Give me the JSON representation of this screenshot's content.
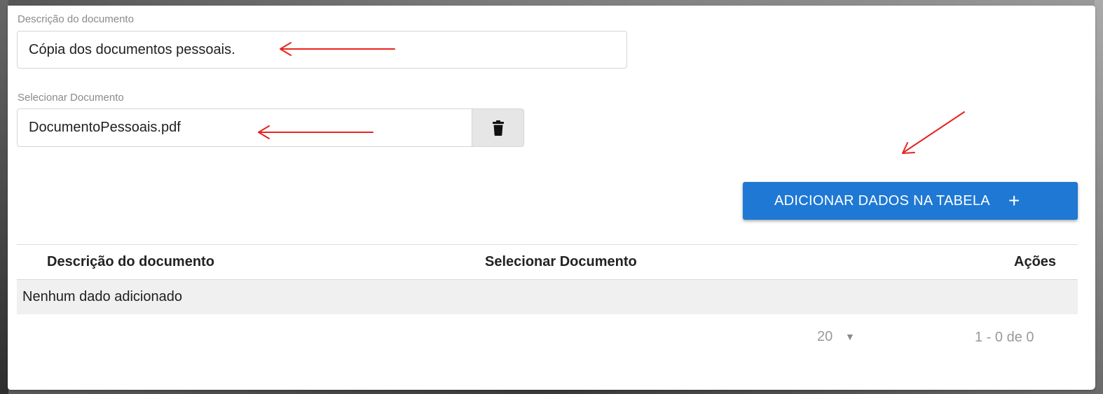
{
  "form": {
    "description_label": "Descrição do documento",
    "description_value": "Cópia dos documentos pessoais.",
    "select_label": "Selecionar Documento",
    "select_value": "DocumentoPessoais.pdf",
    "delete_icon": "trash-icon",
    "add_button_label": "ADICIONAR DADOS NA TABELA",
    "add_button_icon": "+"
  },
  "table": {
    "columns": [
      "Descrição do documento",
      "Selecionar Documento",
      "Ações"
    ],
    "empty_message": "Nenhum dado adicionado"
  },
  "pagination": {
    "page_size": "20",
    "caret": "▼",
    "range": "1 - 0 de 0"
  },
  "colors": {
    "primary": "#1e78d4",
    "annotation_arrow": "#e8231f"
  }
}
